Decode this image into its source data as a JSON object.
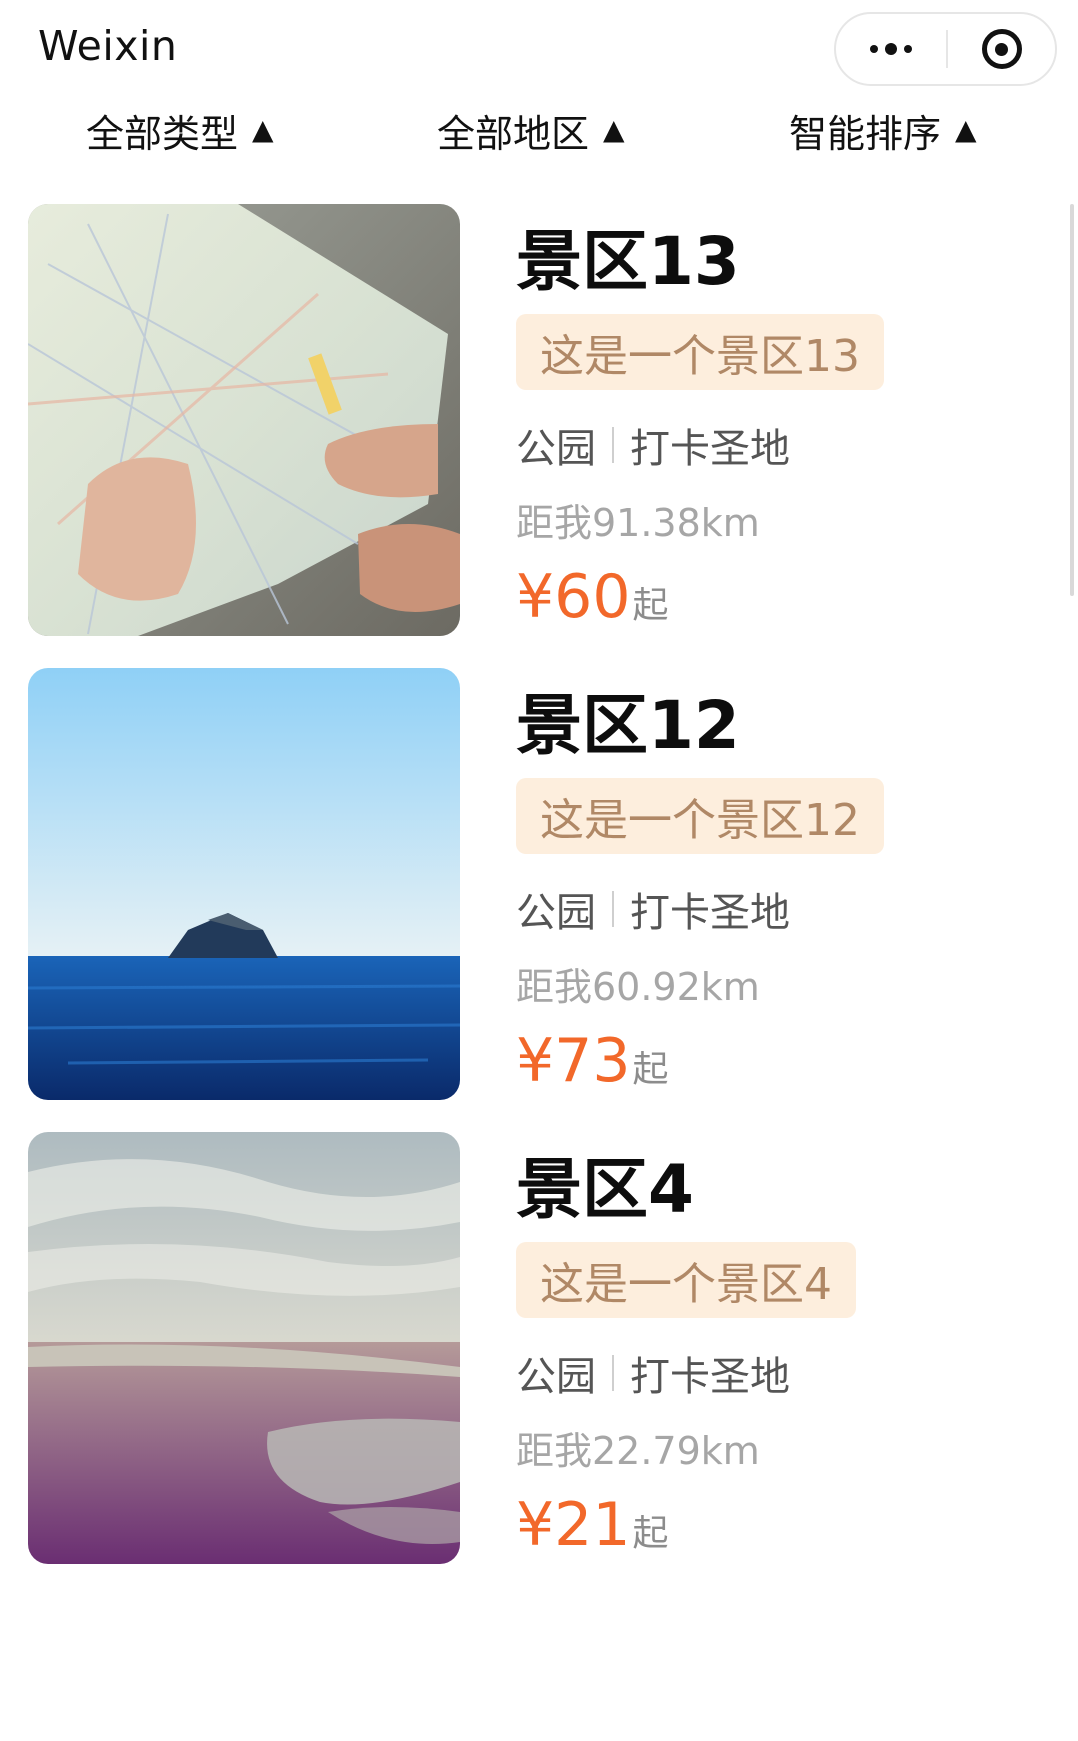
{
  "app": {
    "title": "Weixin"
  },
  "filters": [
    {
      "label": "全部类型",
      "arrow": "▲"
    },
    {
      "label": "全部地区",
      "arrow": "▲"
    },
    {
      "label": "智能排序",
      "arrow": "▲"
    }
  ],
  "scenics": [
    {
      "name": "景区13",
      "description": "这是一个景区13",
      "category": "公园",
      "tag": "打卡圣地",
      "distance": "距我91.38km",
      "price": "¥60",
      "price_suffix": "起",
      "image": "map-photo"
    },
    {
      "name": "景区12",
      "description": "这是一个景区12",
      "category": "公园",
      "tag": "打卡圣地",
      "distance": "距我60.92km",
      "price": "¥73",
      "price_suffix": "起",
      "image": "island-sea-photo"
    },
    {
      "name": "景区4",
      "description": "这是一个景区4",
      "category": "公园",
      "tag": "打卡圣地",
      "distance": "距我22.79km",
      "price": "¥21",
      "price_suffix": "起",
      "image": "beach-photo"
    }
  ],
  "colors": {
    "price": "#f2682a",
    "tag_bg": "#fdeedd",
    "tag_text": "#b08866"
  }
}
